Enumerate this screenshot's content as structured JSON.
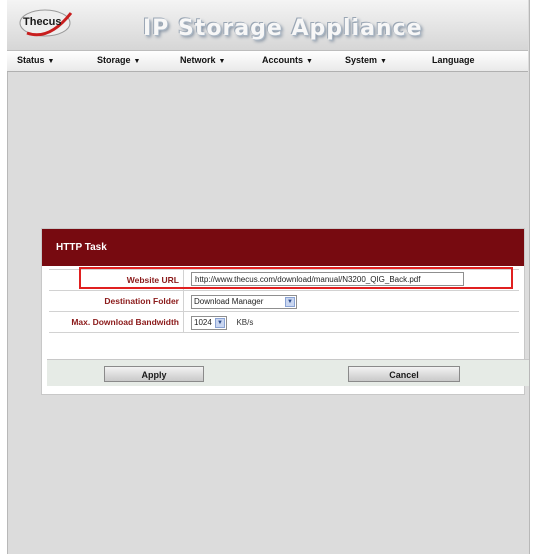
{
  "app": {
    "logo_text": "Thecus",
    "title": "IP Storage Appliance"
  },
  "menu": {
    "items": [
      {
        "label": "Status",
        "caret": "▼"
      },
      {
        "label": "Storage",
        "caret": "▼"
      },
      {
        "label": "Network",
        "caret": "▼"
      },
      {
        "label": "Accounts",
        "caret": "▼"
      },
      {
        "label": "System",
        "caret": "▼"
      },
      {
        "label": "Language",
        "caret": ""
      }
    ]
  },
  "dialog": {
    "title": "HTTP Task",
    "website_url": {
      "label": "Website URL",
      "value": "http://www.thecus.com/download/manual/N3200_QIG_Back.pdf"
    },
    "destination_folder": {
      "label": "Destination Folder",
      "selected": "Download Manager"
    },
    "bandwidth": {
      "label": "Max. Download Bandwidth",
      "selected": "1024",
      "unit": "KB/s"
    },
    "apply_label": "Apply",
    "cancel_label": "Cancel"
  },
  "colors": {
    "dialog_header": "#770a10",
    "label_text": "#8b1a1a",
    "highlight": "#e02020"
  }
}
